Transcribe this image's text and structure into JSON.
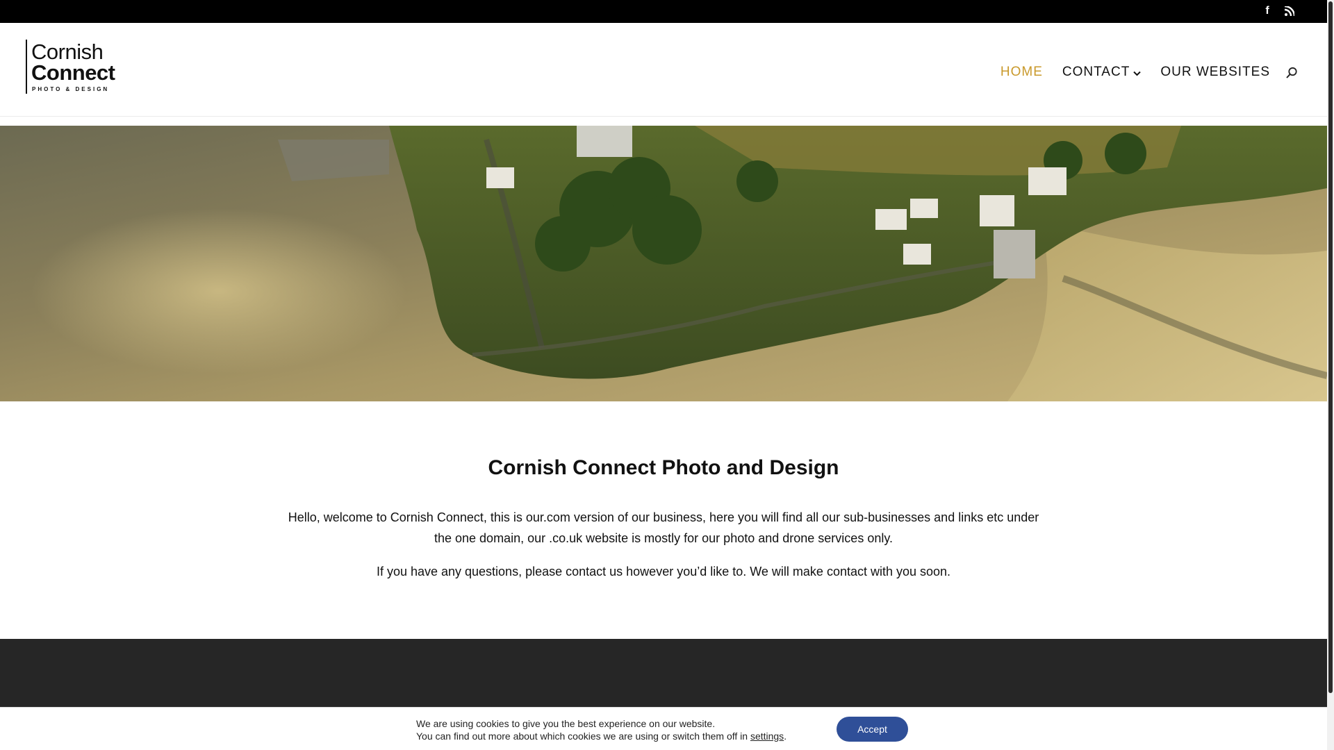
{
  "topbar": {
    "social": [
      {
        "icon": "facebook-icon",
        "glyph": "f"
      },
      {
        "icon": "rss-icon",
        "glyph": ")"
      }
    ]
  },
  "logo": {
    "line1": "Cornish",
    "line2": "Connect",
    "line3": "PHOTO & DESIGN"
  },
  "nav": {
    "items": [
      {
        "label": "HOME",
        "active": true
      },
      {
        "label": "CONTACT",
        "active": false,
        "has_dropdown": true
      },
      {
        "label": "OUR WEBSITES",
        "active": false
      }
    ],
    "search_icon": "search-icon",
    "active_color": "#c9992b"
  },
  "hero": {
    "image": "aerial view of coastal village and tidal estuary"
  },
  "main": {
    "title": "Cornish Connect Photo and Design",
    "paragraph1": "Hello, welcome to Cornish Connect, this is our.com version of our business, here you will find all our sub-businesses and links etc under the one domain, our .co.uk website is mostly for our photo and drone services only.",
    "paragraph2": "If you have any questions, please contact us however you’d like to. We will make contact with you soon."
  },
  "cookie": {
    "line1": "We are using cookies to give you the best experience on our website.",
    "line2_prefix": "You can find out more about which cookies we are using or switch them off in ",
    "settings_link": "settings",
    "line2_suffix": ".",
    "accept_label": "Accept",
    "accept_color": "#2f4f98"
  }
}
